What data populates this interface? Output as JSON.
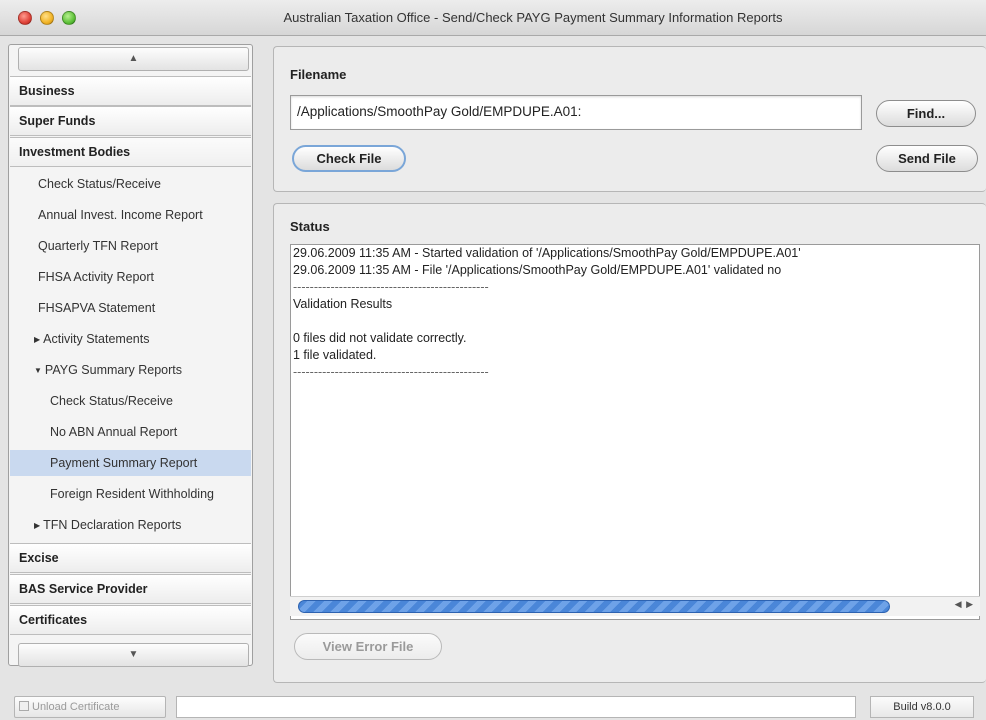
{
  "window": {
    "title": "Australian Taxation Office - Send/Check PAYG Payment Summary Information Reports"
  },
  "sidebar": {
    "scroll_up_glyph": "▲",
    "scroll_down_glyph": "▼",
    "sections": [
      {
        "label": "Business"
      },
      {
        "label": "Super Funds"
      },
      {
        "label": "Investment Bodies"
      }
    ],
    "items": [
      {
        "label": "Check Status/Receive"
      },
      {
        "label": "Annual Invest. Income Report"
      },
      {
        "label": "Quarterly TFN Report"
      },
      {
        "label": "FHSA Activity Report"
      },
      {
        "label": "FHSAPVA Statement"
      },
      {
        "label": "Activity Statements",
        "expander": "▶"
      },
      {
        "label": "PAYG Summary Reports",
        "expander": "▼"
      },
      {
        "label": "Check Status/Receive"
      },
      {
        "label": "No ABN Annual Report"
      },
      {
        "label": "Payment Summary Report",
        "selected": true
      },
      {
        "label": "Foreign Resident Withholding"
      },
      {
        "label": "TFN Declaration Reports",
        "expander": "▶"
      }
    ],
    "bottom_sections": [
      {
        "label": "Excise"
      },
      {
        "label": "BAS Service Provider"
      },
      {
        "label": "Certificates"
      }
    ]
  },
  "file_panel": {
    "filename_label": "Filename",
    "filename_value": "/Applications/SmoothPay Gold/EMPDUPE.A01:",
    "find_button": "Find...",
    "check_button": "Check File",
    "send_button": "Send File"
  },
  "status_panel": {
    "label": "Status",
    "lines": [
      "29.06.2009 11:35 AM - Started validation of '/Applications/SmoothPay Gold/EMPDUPE.A01'",
      "29.06.2009 11:35 AM - File '/Applications/SmoothPay Gold/EMPDUPE.A01' validated no",
      "-----------------------------------------------",
      "Validation Results",
      "",
      "0 files did not validate correctly.",
      "1 file validated.",
      "-----------------------------------------------"
    ],
    "scroll_arrows": "◀ ▶",
    "view_error_button": "View Error File"
  },
  "footer": {
    "unload_button": "Unload Certificate",
    "build_label": "Build v8.0.0"
  }
}
